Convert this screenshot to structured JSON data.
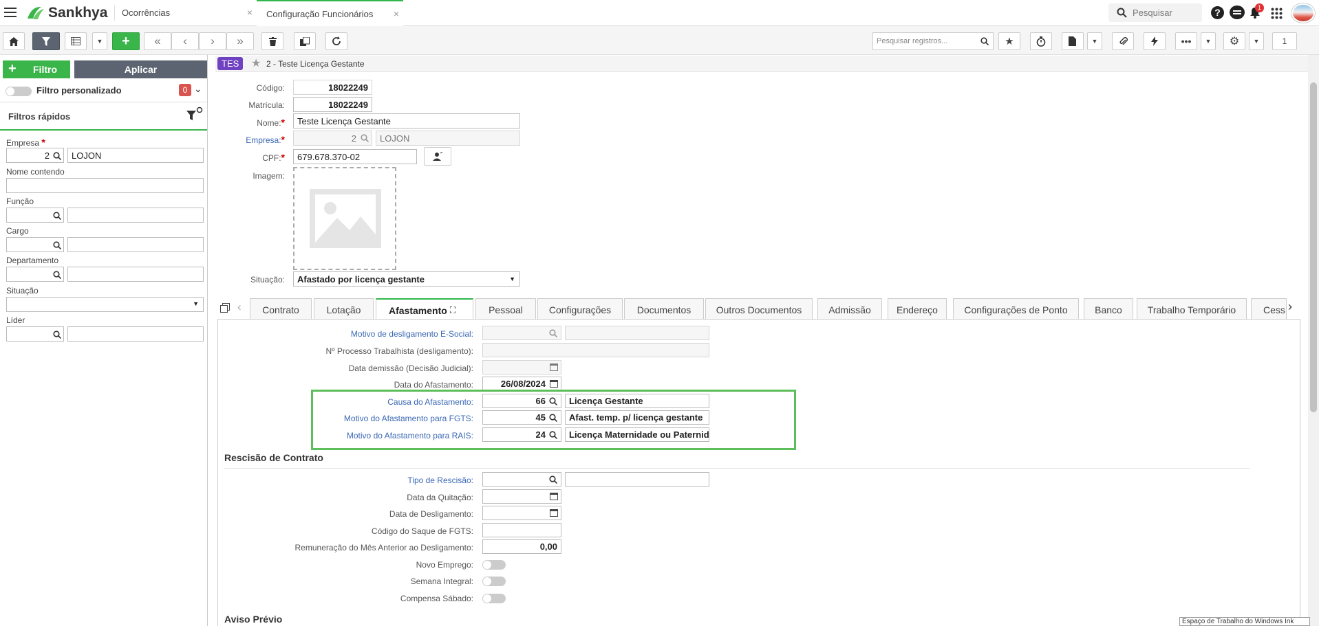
{
  "app": {
    "brand": "Sankhya",
    "tabs": [
      {
        "label": "Ocorrências",
        "active": false
      },
      {
        "label": "Configuração Funcionários",
        "active": true
      }
    ],
    "search_placeholder": "Pesquisar",
    "notification_count": "1",
    "page_number": "1",
    "search_records_placeholder": "Pesquisar registros..."
  },
  "left": {
    "filtro_label": "Filtro",
    "aplicar_label": "Aplicar",
    "filtro_personalizado": "Filtro personalizado",
    "filtro_count": "0",
    "filtros_rapidos": "Filtros rápidos",
    "empresa_label": "Empresa",
    "empresa_code": "2",
    "empresa_name": "LOJON",
    "nome_contendo": "Nome contendo",
    "funcao": "Função",
    "cargo": "Cargo",
    "departamento": "Departamento",
    "situacao": "Situação",
    "lider": "Líder"
  },
  "record": {
    "badge": "TES",
    "title": "2 - Teste Licença Gestante",
    "codigo_label": "Código:",
    "codigo": "18022249",
    "matricula_label": "Matrícula:",
    "matricula": "18022249",
    "nome_label": "Nome:",
    "nome": "Teste Licença Gestante",
    "empresa_label": "Empresa:",
    "empresa_code": "2",
    "empresa_name": "LOJON",
    "cpf_label": "CPF:",
    "cpf": "679.678.370-02",
    "imagem_label": "Imagem:",
    "situacao_label": "Situação:",
    "situacao": "Afastado por licença gestante"
  },
  "tabs": [
    "Contrato",
    "Lotação",
    "Afastamento",
    "Pessoal",
    "Configurações",
    "Documentos",
    "Outros Documentos",
    "Admissão",
    "Endereço",
    "Configurações de Ponto",
    "Banco",
    "Trabalho Temporário",
    "Cess"
  ],
  "afast": {
    "motivo_desl_label": "Motivo de desligamento E-Social:",
    "processo_label": "Nº Processo Trabalhista (desligamento):",
    "data_demissao_label": "Data demissão (Decisão Judicial):",
    "data_afast_label": "Data do Afastamento:",
    "data_afast": "26/08/2024",
    "causa_label": "Causa do Afastamento:",
    "causa_code": "66",
    "causa_desc": "Licença Gestante",
    "fgts_label": "Motivo do Afastamento para FGTS:",
    "fgts_code": "45",
    "fgts_desc": "Afast. temp. p/ licença gestante",
    "rais_label": "Motivo do Afastamento para RAIS:",
    "rais_code": "24",
    "rais_desc": "Licença Maternidade ou Paternid"
  },
  "rescisao": {
    "title": "Rescisão de Contrato",
    "tipo_label": "Tipo de Rescisão:",
    "quitacao_label": "Data da Quitação:",
    "desligamento_label": "Data de Desligamento:",
    "saque_label": "Código do Saque de FGTS:",
    "remuneracao_label": "Remuneração do Mês Anterior ao Desligamento:",
    "remuneracao": "0,00",
    "novo_emprego_label": "Novo Emprego:",
    "semana_integral_label": "Semana Integral:",
    "compensa_sabado_label": "Compensa Sábado:"
  },
  "aviso_previo": "Aviso Prévio",
  "tooltip": "Espaço de Trabalho do Windows Ink",
  "colors": {
    "accent_green": "#39b54a",
    "highlight_box": "#5cbf5c",
    "link_blue": "#3a68b5"
  }
}
